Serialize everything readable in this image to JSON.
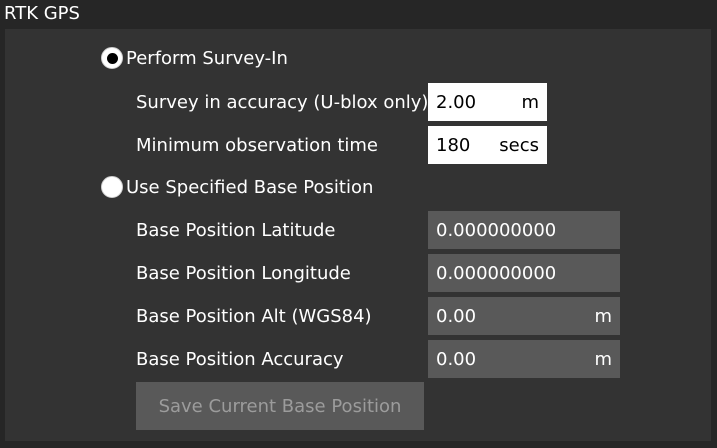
{
  "window": {
    "title": "RTK GPS"
  },
  "survey_in": {
    "label": "Perform Survey-In",
    "selected": true,
    "accuracy": {
      "label": "Survey in accuracy (U-blox only)",
      "value": "2.00",
      "unit": "m"
    },
    "min_obs_time": {
      "label": "Minimum observation time",
      "value": "180",
      "unit": "secs"
    }
  },
  "specified_base": {
    "label": "Use Specified Base Position",
    "selected": false,
    "latitude": {
      "label": "Base Position Latitude",
      "value": "0.000000000",
      "unit": ""
    },
    "longitude": {
      "label": "Base Position Longitude",
      "value": "0.000000000",
      "unit": ""
    },
    "altitude": {
      "label": "Base Position Alt (WGS84)",
      "value": "0.00",
      "unit": "m"
    },
    "accuracy": {
      "label": "Base Position Accuracy",
      "value": "0.00",
      "unit": "m"
    },
    "save_button": "Save Current Base Position"
  },
  "colors": {
    "background": "#262626",
    "panel": "#333333",
    "disabled_field": "#595959",
    "disabled_text": "#9c9c9c"
  }
}
